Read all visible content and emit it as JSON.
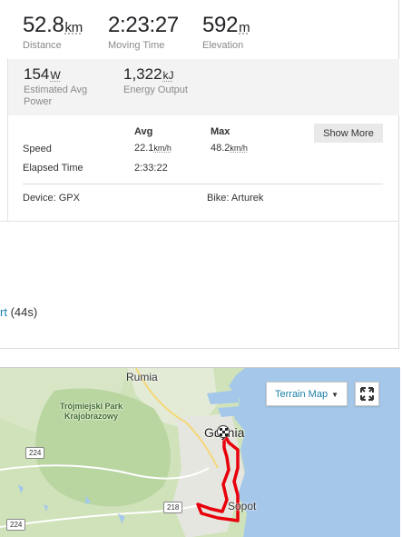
{
  "stats": [
    {
      "value": "52.8",
      "unit": "km",
      "label": "Distance"
    },
    {
      "value": "2:23:27",
      "unit": "",
      "label": "Moving Time"
    },
    {
      "value": "592",
      "unit": "m",
      "label": "Elevation"
    }
  ],
  "power": {
    "value": "154",
    "unit": "W",
    "label": "Estimated Avg Power"
  },
  "energy": {
    "value": "1,322",
    "unit": "kJ",
    "label": "Energy Output"
  },
  "table": {
    "col_avg": "Avg",
    "col_max": "Max",
    "speed_label": "Speed",
    "speed_avg": "22.1",
    "speed_avg_unit": "km/h",
    "speed_max": "48.2",
    "speed_max_unit": "km/h",
    "elapsed_label": "Elapsed Time",
    "elapsed_avg": "2:33:22"
  },
  "show_more_label": "Show More",
  "device": "Device: GPX",
  "bike": "Bike: Arturek",
  "partial_text": {
    "link": "rt",
    "rest": " (44s)"
  },
  "map": {
    "type_button": "Terrain Map",
    "caret_icon": "caret-down-icon",
    "fullscreen_icon": "fullscreen-icon",
    "finish_icon": "checkered-flag-icon",
    "labels": {
      "rumia": "Rumia",
      "park": "Trójmiejski Park\nKrajobrazowy",
      "gdynia": "Gdynia",
      "sopot": "Sopot"
    },
    "shields": {
      "r224a": "224",
      "r224b": "224",
      "r218": "218"
    },
    "route_color": "#e8000b",
    "sea_color": "#a5c8ea",
    "land_color": "#cfe2b9"
  }
}
